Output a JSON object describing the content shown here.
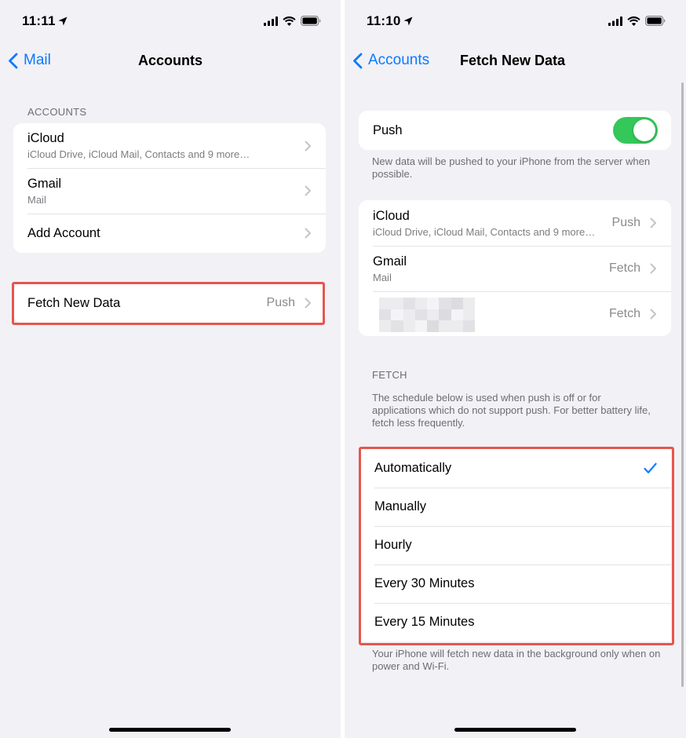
{
  "left": {
    "status": {
      "time": "11:11"
    },
    "nav": {
      "back_label": "Mail",
      "title": "Accounts"
    },
    "accounts_header": "ACCOUNTS",
    "accounts": [
      {
        "title": "iCloud",
        "subtitle": "iCloud Drive, iCloud Mail, Contacts and 9 more…"
      },
      {
        "title": "Gmail",
        "subtitle": "Mail"
      },
      {
        "title": "Add Account"
      }
    ],
    "fetch_row": {
      "label": "Fetch New Data",
      "value": "Push"
    }
  },
  "right": {
    "status": {
      "time": "11:10"
    },
    "nav": {
      "back_label": "Accounts",
      "title": "Fetch New Data"
    },
    "push": {
      "label": "Push",
      "enabled": true,
      "footer": "New data will be pushed to your iPhone from the server when possible."
    },
    "accounts": [
      {
        "title": "iCloud",
        "subtitle": "iCloud Drive, iCloud Mail, Contacts and 9 more…",
        "value": "Push"
      },
      {
        "title": "Gmail",
        "subtitle": "Mail",
        "value": "Fetch"
      },
      {
        "title": "",
        "value": "Fetch"
      }
    ],
    "fetch_header": "FETCH",
    "fetch_description": "The schedule below is used when push is off or for applications which do not support push. For better battery life, fetch less frequently.",
    "schedule_options": [
      {
        "label": "Automatically",
        "selected": true
      },
      {
        "label": "Manually"
      },
      {
        "label": "Hourly"
      },
      {
        "label": "Every 30 Minutes"
      },
      {
        "label": "Every 15 Minutes"
      }
    ],
    "schedule_footer": "Your iPhone will fetch new data in the background only when on power and Wi-Fi."
  },
  "colors": {
    "accent": "#0a7aff",
    "toggle_on": "#34c759",
    "highlight": "#e5564e",
    "background": "#f2f1f6"
  }
}
